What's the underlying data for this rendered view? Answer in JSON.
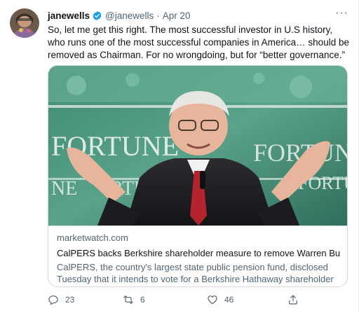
{
  "tweet": {
    "display_name": "janewells",
    "handle": "@janewells",
    "separator": "·",
    "date": "Apr 20",
    "more_label": "···",
    "text": "So, let me get this right. The most successful investor in U.S history, who runs one of the most successful companies in America… should be removed as Chairman. For no wrongdoing, but for “better governance.”"
  },
  "card": {
    "banner_words": [
      "FORTUNE",
      "FORTUNE",
      "NE",
      "FORTUNE",
      "RTUNE"
    ],
    "domain": "marketwatch.com",
    "title": "CalPERS backs Berkshire shareholder measure to remove Warren Buff…",
    "description": "CalPERS, the country's largest state public pension fund, disclosed Tuesday that it intends to vote for a Berkshire Hathaway shareholder …"
  },
  "actions": {
    "reply_count": "23",
    "retweet_count": "6",
    "like_count": "46"
  },
  "icons": {
    "verified": "verified-badge-icon",
    "reply": "reply-icon",
    "retweet": "retweet-icon",
    "like": "heart-icon",
    "share": "share-icon"
  },
  "colors": {
    "verified": "#1d9bf0",
    "text": "#0f1419",
    "secondary": "#536471",
    "border": "#cfd9de"
  }
}
